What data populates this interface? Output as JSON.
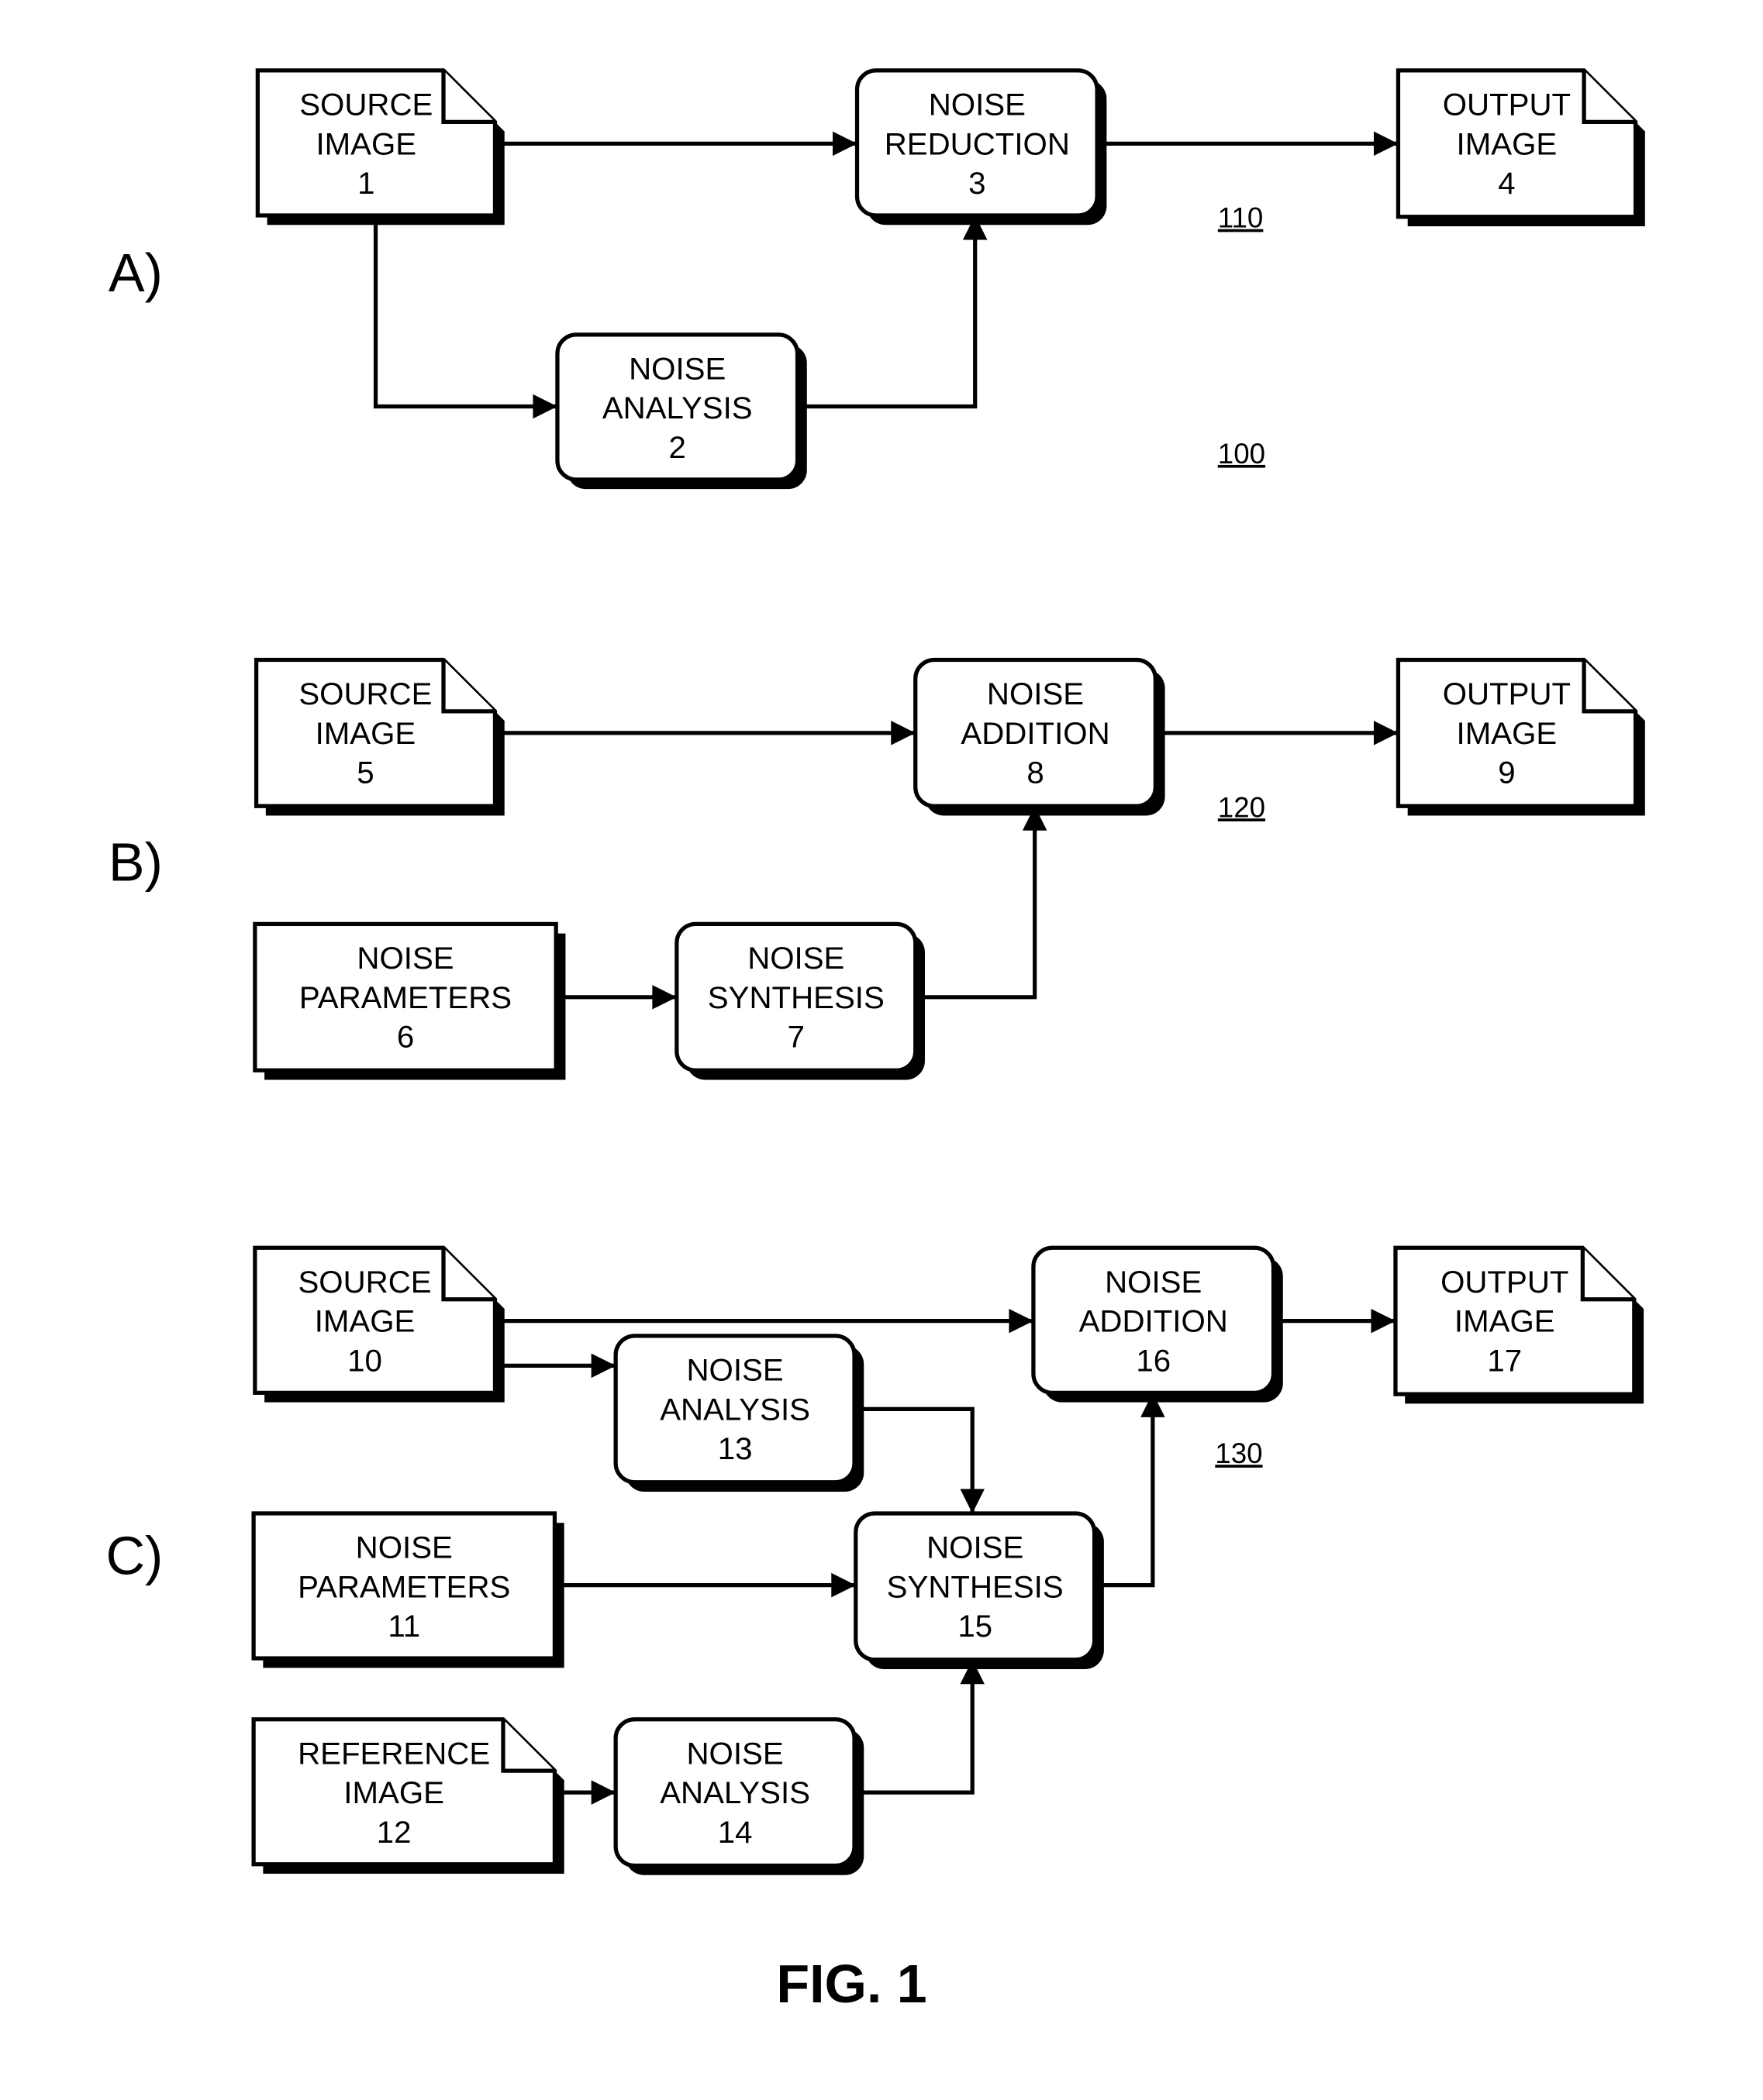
{
  "figure": {
    "caption": "FIG. 1",
    "overall_ref": "100"
  },
  "sections": [
    {
      "id": "A",
      "label": "A)",
      "ref": "110",
      "blocks": [
        {
          "id": "b1",
          "type": "document",
          "lines": [
            "SOURCE",
            "IMAGE",
            "1"
          ]
        },
        {
          "id": "b2",
          "type": "process",
          "lines": [
            "NOISE",
            "ANALYSIS",
            "2"
          ]
        },
        {
          "id": "b3",
          "type": "process",
          "lines": [
            "NOISE",
            "REDUCTION",
            "3"
          ]
        },
        {
          "id": "b4",
          "type": "document",
          "lines": [
            "OUTPUT",
            "IMAGE",
            "4"
          ]
        }
      ],
      "connections": [
        [
          "b1",
          "b3"
        ],
        [
          "b1",
          "b2"
        ],
        [
          "b2",
          "b3"
        ],
        [
          "b3",
          "b4"
        ]
      ]
    },
    {
      "id": "B",
      "label": "B)",
      "ref": "120",
      "blocks": [
        {
          "id": "b5",
          "type": "document",
          "lines": [
            "SOURCE",
            "IMAGE",
            "5"
          ]
        },
        {
          "id": "b6",
          "type": "data",
          "lines": [
            "NOISE",
            "PARAMETERS",
            "6"
          ]
        },
        {
          "id": "b7",
          "type": "process",
          "lines": [
            "NOISE",
            "SYNTHESIS",
            "7"
          ]
        },
        {
          "id": "b8",
          "type": "process",
          "lines": [
            "NOISE",
            "ADDITION",
            "8"
          ]
        },
        {
          "id": "b9",
          "type": "document",
          "lines": [
            "OUTPUT",
            "IMAGE",
            "9"
          ]
        }
      ],
      "connections": [
        [
          "b5",
          "b8"
        ],
        [
          "b6",
          "b7"
        ],
        [
          "b7",
          "b8"
        ],
        [
          "b8",
          "b9"
        ]
      ]
    },
    {
      "id": "C",
      "label": "C)",
      "ref": "130",
      "blocks": [
        {
          "id": "b10",
          "type": "document",
          "lines": [
            "SOURCE",
            "IMAGE",
            "10"
          ]
        },
        {
          "id": "b11",
          "type": "data",
          "lines": [
            "NOISE",
            "PARAMETERS",
            "11"
          ]
        },
        {
          "id": "b12",
          "type": "document",
          "lines": [
            "REFERENCE",
            "IMAGE",
            "12"
          ]
        },
        {
          "id": "b13",
          "type": "process",
          "lines": [
            "NOISE",
            "ANALYSIS",
            "13"
          ]
        },
        {
          "id": "b14",
          "type": "process",
          "lines": [
            "NOISE",
            "ANALYSIS",
            "14"
          ]
        },
        {
          "id": "b15",
          "type": "process",
          "lines": [
            "NOISE",
            "SYNTHESIS",
            "15"
          ]
        },
        {
          "id": "b16",
          "type": "process",
          "lines": [
            "NOISE",
            "ADDITION",
            "16"
          ]
        },
        {
          "id": "b17",
          "type": "document",
          "lines": [
            "OUTPUT",
            "IMAGE",
            "17"
          ]
        }
      ],
      "connections": [
        [
          "b10",
          "b16"
        ],
        [
          "b10",
          "b13"
        ],
        [
          "b13",
          "b15"
        ],
        [
          "b11",
          "b15"
        ],
        [
          "b12",
          "b14"
        ],
        [
          "b14",
          "b15"
        ],
        [
          "b15",
          "b16"
        ],
        [
          "b16",
          "b17"
        ]
      ]
    }
  ]
}
